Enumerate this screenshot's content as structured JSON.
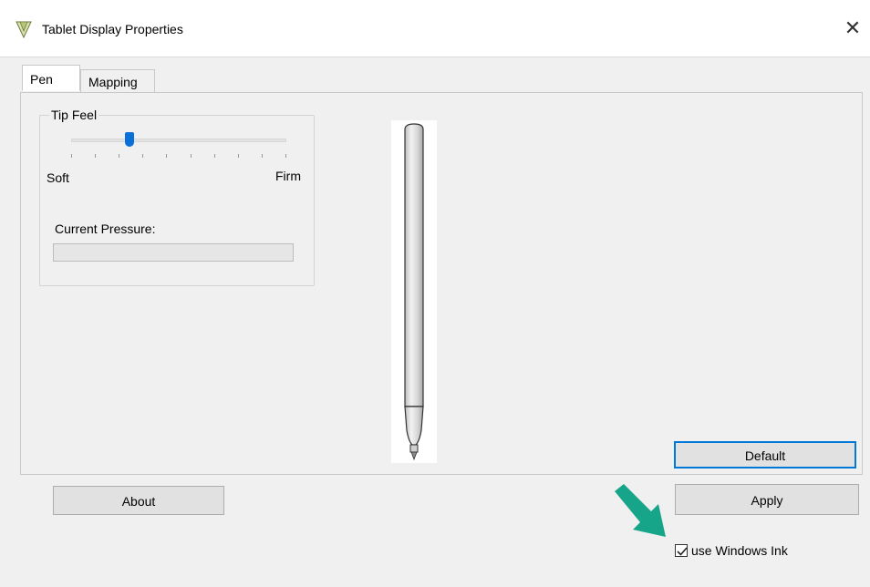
{
  "window": {
    "title": "Tablet Display Properties",
    "close_glyph": "✕",
    "app_icon": "tablet-pen-icon"
  },
  "tabs": [
    {
      "label": "Pen",
      "active": true
    },
    {
      "label": "Mapping",
      "active": false
    }
  ],
  "pen_tab": {
    "tip_feel": {
      "group_label": "Tip Feel",
      "min_label": "Soft",
      "max_label": "Firm",
      "slider_value_fraction": 0.26,
      "tick_count": 10
    },
    "pressure": {
      "label": "Current Pressure:",
      "value_fraction": 0
    },
    "default_button": "Default"
  },
  "buttons": {
    "about": "About",
    "apply": "Apply"
  },
  "windows_ink": {
    "label": "use Windows Ink",
    "checked": true
  },
  "colors": {
    "accent": "#0078d7",
    "arrow": "#17a589"
  }
}
